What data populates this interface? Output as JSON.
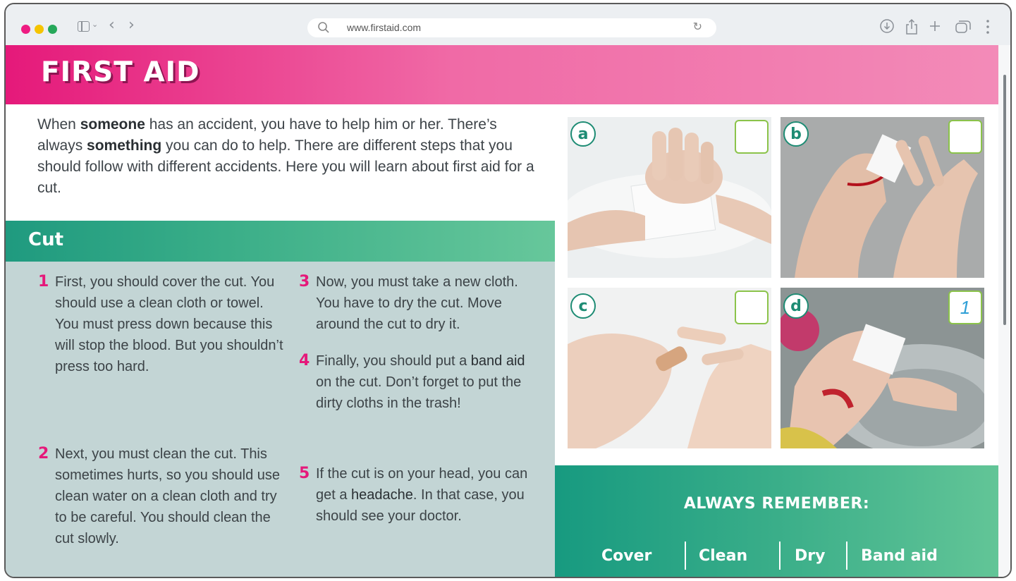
{
  "browser": {
    "url": "www.firstaid.com"
  },
  "header": {
    "title": "FIRST AID"
  },
  "intro": {
    "p1": "When ",
    "b1": "someone",
    "p2": " has an accident, you have to help him or her. There’s always ",
    "b2": "something",
    "p3": " you can do to help. There are different steps that you should follow with different accidents. Here you will learn about first aid for a cut."
  },
  "cut": {
    "title": "Cut",
    "steps": [
      {
        "num": "1",
        "text": "First, you should cover the cut. You should use a clean cloth or towel. You must press down because this will stop the blood. But you shouldn’t press too hard."
      },
      {
        "num": "2",
        "text": "Next, you must clean the cut. This sometimes hurts, so you should use clean water on a clean cloth and try to be careful. You should clean the cut slowly."
      },
      {
        "num": "3",
        "text": "Now, you must take a new cloth. You have to dry the cut. Move around the cut to dry it."
      },
      {
        "num": "4",
        "pre": "Finally, you should put a ",
        "bold": "band aid",
        "post": " on the cut. Don’t forget to put the dirty cloths in the trash!"
      },
      {
        "num": "5",
        "pre": "If the cut is on your head, you can get a ",
        "bold": "headache",
        "post": ". In that case, you should see your doctor."
      }
    ]
  },
  "photos": [
    {
      "letter": "a",
      "answer": ""
    },
    {
      "letter": "b",
      "answer": ""
    },
    {
      "letter": "c",
      "answer": ""
    },
    {
      "letter": "d",
      "answer": "1"
    }
  ],
  "remember": {
    "title": "ALWAYS REMEMBER:",
    "items": [
      "Cover",
      "Clean",
      "Dry",
      "Band aid"
    ]
  },
  "colors": {
    "pink": "#e5197a",
    "green": "#1e8c74",
    "light_green_border": "#8bc34a",
    "steps_bg": "#c3d5d5"
  }
}
